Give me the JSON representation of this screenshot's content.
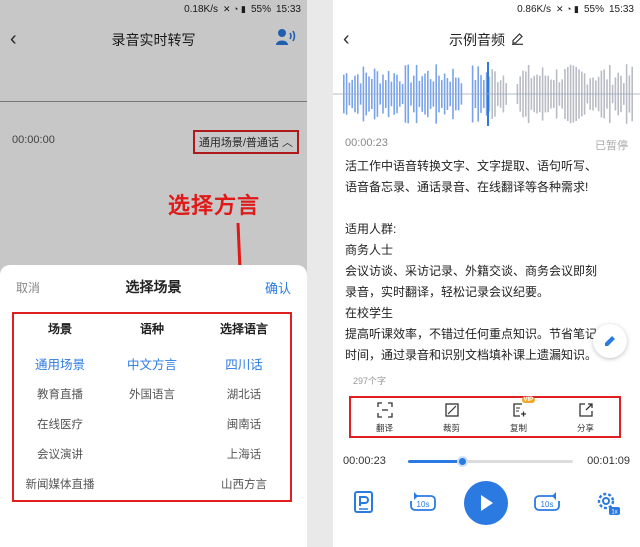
{
  "status": {
    "speed_left": "0.18K/s",
    "speed_right": "0.86K/s",
    "battery": "55%",
    "time": "15:33"
  },
  "left": {
    "title": "录音实时转写",
    "time": "00:00:00",
    "scene_selector": "通用场景/普通话",
    "annotation": "选择方言",
    "sheet": {
      "cancel": "取消",
      "title": "选择场景",
      "confirm": "确认",
      "columns": [
        {
          "title": "场景",
          "options": [
            "通用场景",
            "教育直播",
            "在线医疗",
            "会议演讲",
            "新闻媒体直播"
          ],
          "selected": 0
        },
        {
          "title": "语种",
          "options": [
            "中文方言",
            "外国语言"
          ],
          "selected": 0
        },
        {
          "title": "选择语言",
          "options": [
            "四川话",
            "湖北话",
            "闽南话",
            "上海话",
            "山西方言"
          ],
          "selected": 0
        }
      ]
    }
  },
  "right": {
    "title": "示例音频",
    "current_time": "00:00:23",
    "state": "已暂停",
    "text_lines": [
      "活工作中语音转换文字、文字提取、语句听写、",
      "语音备忘录、通话录音、在线翻译等各种需求!",
      "",
      "适用人群:",
      "商务人士",
      "会议访谈、采访记录、外籍交谈、商务会议即刻",
      "录音，实时翻译，轻松记录会议纪要。",
      "在校学生",
      "提高听课效率，不错过任何重点知识。节省笔记",
      "时间，通过录音和识别文档填补课上遗漏知识。"
    ],
    "char_count": "297个字",
    "tools": [
      {
        "label": "翻译",
        "icon": "translate-icon"
      },
      {
        "label": "裁剪",
        "icon": "crop-icon"
      },
      {
        "label": "复制",
        "icon": "copy-icon",
        "badge": "VIP"
      },
      {
        "label": "分享",
        "icon": "share-icon"
      }
    ],
    "progress": {
      "elapsed": "00:00:23",
      "total": "00:01:09",
      "fraction": 0.33
    },
    "controls": {
      "rewind": "10s",
      "forward": "10s",
      "speed": "1x"
    }
  },
  "colors": {
    "accent": "#2a7ae2",
    "highlight": "#e02020",
    "wave_played": "#7aa4e8",
    "wave_unplayed": "#b9bcc4"
  }
}
